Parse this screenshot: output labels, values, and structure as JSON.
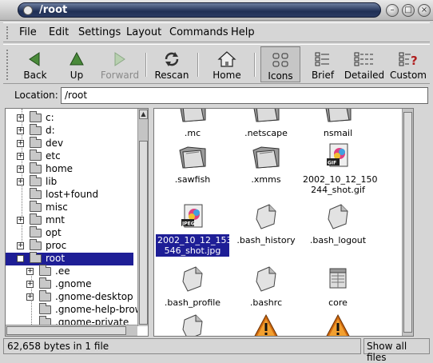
{
  "window": {
    "title": "/root"
  },
  "menu": [
    "File",
    "Edit",
    "Settings",
    "Layout",
    "Commands",
    "Help"
  ],
  "toolbar": {
    "back": "Back",
    "up": "Up",
    "forward": "Forward",
    "rescan": "Rescan",
    "home": "Home",
    "icons": "Icons",
    "brief": "Brief",
    "detailed": "Detailed",
    "custom": "Custom"
  },
  "location": {
    "label": "Location:",
    "value": "/root"
  },
  "tree": [
    {
      "label": "c:",
      "expander": "+"
    },
    {
      "label": "d:",
      "expander": "+"
    },
    {
      "label": "dev",
      "expander": "+"
    },
    {
      "label": "etc",
      "expander": "+"
    },
    {
      "label": "home",
      "expander": "+"
    },
    {
      "label": "lib",
      "expander": "+"
    },
    {
      "label": "lost+found",
      "expander": ""
    },
    {
      "label": "misc",
      "expander": ""
    },
    {
      "label": "mnt",
      "expander": "+"
    },
    {
      "label": "opt",
      "expander": ""
    },
    {
      "label": "proc",
      "expander": "+"
    },
    {
      "label": "root",
      "expander": "−",
      "selected": true
    },
    {
      "label": ".ee",
      "expander": "+",
      "child": true
    },
    {
      "label": ".gnome",
      "expander": "+",
      "child": true
    },
    {
      "label": ".gnome-desktop",
      "expander": "+",
      "child": true
    },
    {
      "label": ".gnome-help-brow",
      "expander": "",
      "child": true
    },
    {
      "label": ".gnome-private",
      "expander": "",
      "child": true
    }
  ],
  "files": [
    {
      "label": ".mc",
      "icon": "folder-icon"
    },
    {
      "label": ".netscape",
      "icon": "folder-icon"
    },
    {
      "label": "nsmail",
      "icon": "folder-icon"
    },
    {
      "label": ".sawfish",
      "icon": "folder-icon"
    },
    {
      "label": ".xmms",
      "icon": "folder-icon"
    },
    {
      "label": "2002_10_12_150 244_shot.gif",
      "icon": "gif-image-icon"
    },
    {
      "label": "2002_10_12_153 546_shot.jpg",
      "icon": "jpeg-image-icon",
      "selected": true
    },
    {
      "label": ".bash_history",
      "icon": "document-icon"
    },
    {
      "label": ".bash_logout",
      "icon": "document-icon"
    },
    {
      "label": ".bash_profile",
      "icon": "document-icon"
    },
    {
      "label": ".bashrc",
      "icon": "document-icon"
    },
    {
      "label": "core",
      "icon": "core-file-icon"
    },
    {
      "label": "",
      "icon": "document-icon"
    },
    {
      "label": "",
      "icon": "warning-icon"
    },
    {
      "label": "",
      "icon": "warning-icon"
    }
  ],
  "status": {
    "left": "62,658 bytes in 1 file",
    "right": "Show all files"
  }
}
